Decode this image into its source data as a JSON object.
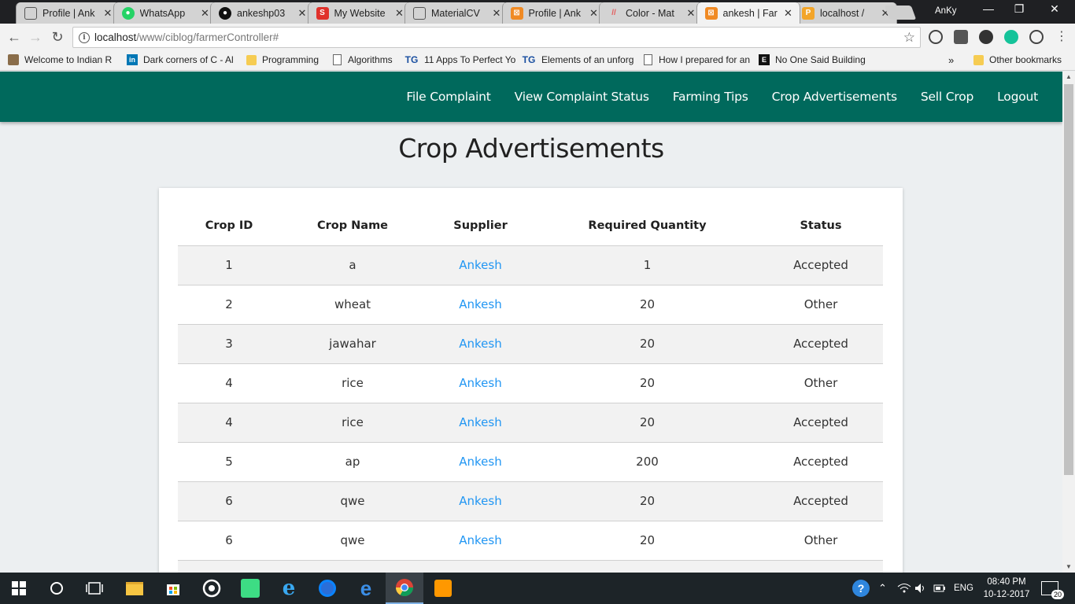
{
  "browser": {
    "tabs": [
      {
        "title": "Profile | Ank",
        "favicon": "document-icon",
        "active": false
      },
      {
        "title": "WhatsApp",
        "favicon": "whatsapp-icon",
        "active": false
      },
      {
        "title": "ankeshp03",
        "favicon": "github-icon",
        "active": false
      },
      {
        "title": "My Website",
        "favicon": "s-logo-icon",
        "active": false
      },
      {
        "title": "MaterialCV",
        "favicon": "document-icon",
        "active": false
      },
      {
        "title": "Profile | Ank",
        "favicon": "xampp-icon",
        "active": false
      },
      {
        "title": "Color - Mat",
        "favicon": "material-icon",
        "active": false
      },
      {
        "title": "ankesh | Far",
        "favicon": "xampp-icon",
        "active": true
      },
      {
        "title": "localhost /",
        "favicon": "phpmyadmin-icon",
        "active": false
      }
    ],
    "tab_close_glyph": "✕",
    "profile_name": "AnKy",
    "url_host": "localhost",
    "url_path": "/www/ciblog/farmerController#",
    "bookmarks": [
      {
        "label": "Welcome to Indian R",
        "icon": "site-icon"
      },
      {
        "label": "Dark corners of C - Al",
        "icon": "linkedin-icon"
      },
      {
        "label": "Programming",
        "icon": "folder-icon"
      },
      {
        "label": "Algorithms",
        "icon": "document-icon"
      },
      {
        "label": "11 Apps To Perfect Yo",
        "icon": "tg-icon"
      },
      {
        "label": "Elements of an unforg",
        "icon": "tg-icon"
      },
      {
        "label": "How I prepared for an",
        "icon": "document-icon"
      },
      {
        "label": "No One Said Building",
        "icon": "e-icon"
      }
    ],
    "bookmarks_overflow": "»",
    "other_bookmarks": "Other bookmarks"
  },
  "app": {
    "nav": [
      {
        "label": "File Complaint"
      },
      {
        "label": "View Complaint Status"
      },
      {
        "label": "Farming Tips"
      },
      {
        "label": "Crop Advertisements"
      },
      {
        "label": "Sell Crop"
      },
      {
        "label": "Logout"
      }
    ],
    "page_title": "Crop Advertisements",
    "colors": {
      "header": "#00695c",
      "link": "#2196f3",
      "background": "#eceff1"
    },
    "table": {
      "headers": [
        "Crop ID",
        "Crop Name",
        "Supplier",
        "Required Quantity",
        "Status"
      ],
      "rows": [
        [
          "1",
          "a",
          "Ankesh",
          "1",
          "Accepted"
        ],
        [
          "2",
          "wheat",
          "Ankesh",
          "20",
          "Other"
        ],
        [
          "3",
          "jawahar",
          "Ankesh",
          "20",
          "Accepted"
        ],
        [
          "4",
          "rice",
          "Ankesh",
          "20",
          "Other"
        ],
        [
          "4",
          "rice",
          "Ankesh",
          "20",
          "Accepted"
        ],
        [
          "5",
          "ap",
          "Ankesh",
          "200",
          "Accepted"
        ],
        [
          "6",
          "qwe",
          "Ankesh",
          "20",
          "Accepted"
        ],
        [
          "6",
          "qwe",
          "Ankesh",
          "20",
          "Other"
        ]
      ]
    }
  },
  "taskbar": {
    "language": "ENG",
    "time": "08:40 PM",
    "date": "10-12-2017",
    "notification_count": "20"
  }
}
